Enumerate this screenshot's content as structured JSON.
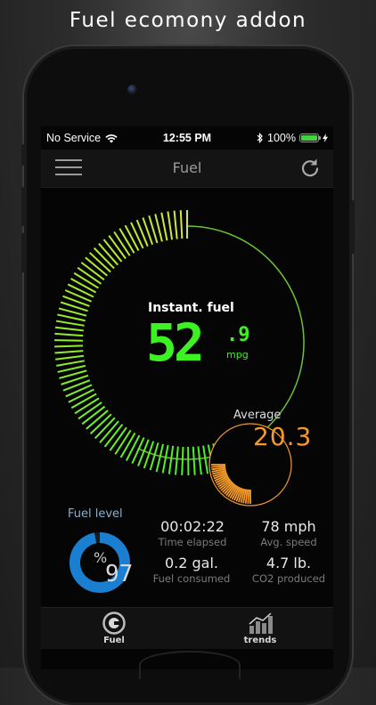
{
  "promo": {
    "title": "Fuel ecomony addon"
  },
  "status_bar": {
    "carrier": "No Service",
    "time": "12:55 PM",
    "battery_percent": "100%",
    "battery_level": 1.0,
    "icons": [
      "wifi-icon",
      "bluetooth-icon",
      "battery-icon",
      "charging-bolt-icon"
    ]
  },
  "navbar": {
    "title": "Fuel",
    "menu_icon": "hamburger-menu-icon",
    "refresh_icon": "refresh-icon"
  },
  "instant_fuel": {
    "label": "Instant. fuel",
    "integer": "52",
    "decimal": ".9",
    "unit": "mpg",
    "gauge_fraction": 0.6
  },
  "average": {
    "label": "Average",
    "value": "20.3",
    "gauge_fraction": 0.35
  },
  "fuel_level": {
    "label": "Fuel level",
    "symbol": "%",
    "value": "97",
    "fraction": 0.97
  },
  "stats": [
    {
      "value": "00:02:22",
      "caption": "Time elapsed"
    },
    {
      "value": "78 mph",
      "caption": "Avg. speed"
    },
    {
      "value": "0.2 gal.",
      "caption": "Fuel consumed"
    },
    {
      "value": "4.7 lb.",
      "caption": "CO2 produced"
    }
  ],
  "tabs": [
    {
      "label": "Fuel",
      "icon": "fuel-gauge-icon"
    },
    {
      "label": "trends",
      "icon": "trends-chart-icon"
    }
  ],
  "colors": {
    "instant_gauge": "#3df223",
    "average_gauge": "#f39a2b",
    "fuel_ring": "#1a7fd0",
    "background": "#050505"
  }
}
